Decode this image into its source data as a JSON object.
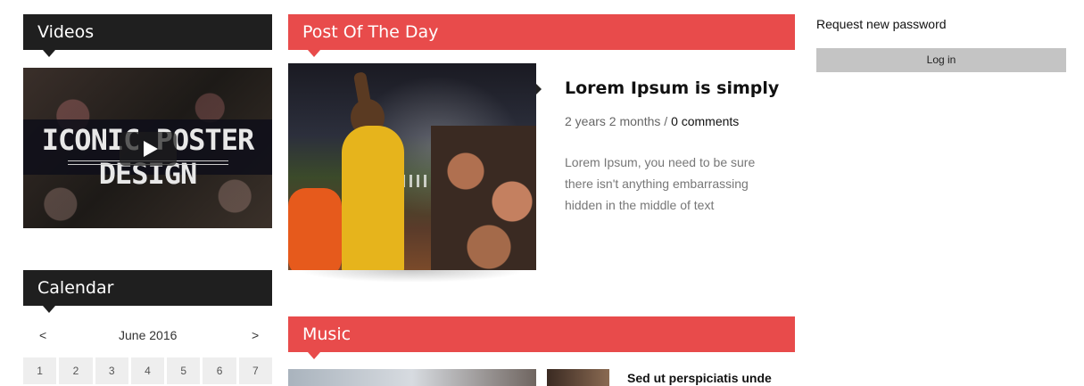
{
  "videos": {
    "title": "Videos",
    "poster_text": "ICONIC POSTER DESIGN"
  },
  "calendar": {
    "title": "Calendar",
    "prev": "<",
    "next": ">",
    "month": "June 2016",
    "days": [
      "1",
      "2",
      "3",
      "4",
      "5",
      "6",
      "7"
    ]
  },
  "post_of_day": {
    "title": "Post Of The Day",
    "post_title": "Lorem Ipsum is simply",
    "date": "2 years 2 months",
    "separator": " / ",
    "comments": "0 comments",
    "body": "Lorem Ipsum, you need to be sure there isn't anything embarrassing hidden in the middle of text"
  },
  "music": {
    "title": "Music",
    "item_title": "Sed ut perspiciatis unde"
  },
  "account": {
    "request_password": "Request new password",
    "login_label": "Log in"
  },
  "colors": {
    "accent": "#e84b4b",
    "dark": "#1f1f1f"
  }
}
